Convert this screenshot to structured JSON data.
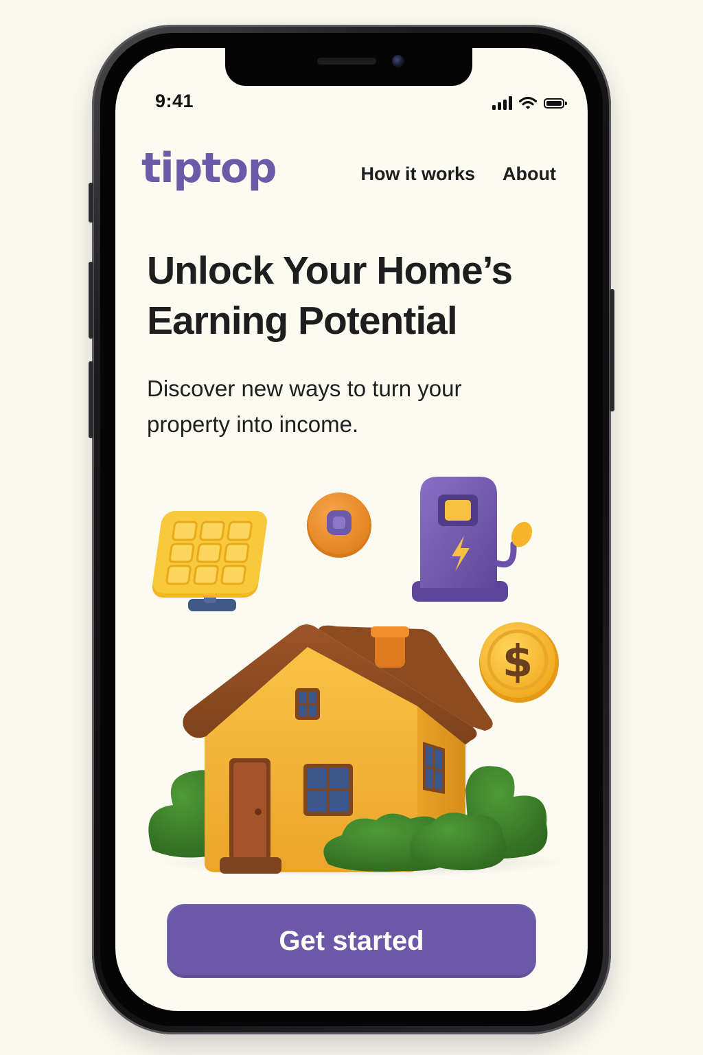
{
  "status_bar": {
    "time": "9:41",
    "signal_icon": "cellular-signal-icon",
    "wifi_icon": "wifi-icon",
    "battery_icon": "battery-icon"
  },
  "header": {
    "logo": "tiptop",
    "nav": [
      {
        "label": "How it works"
      },
      {
        "label": "About"
      }
    ]
  },
  "hero": {
    "title": "Unlock Your Home’s Earning Potential",
    "subtitle": "Discover new ways to turn your property into income."
  },
  "illustration": {
    "items": [
      "solar-panel-icon",
      "smart-sensor-icon",
      "ev-charger-icon",
      "dollar-coin-icon",
      "house-icon",
      "bushes"
    ],
    "coin_symbol": "$"
  },
  "cta": {
    "label": "Get started"
  },
  "colors": {
    "brand": "#6b58a7",
    "background": "#fcfbf2",
    "text": "#1e1e1e",
    "house_wall": "#f5b335",
    "roof": "#8b4a22",
    "foliage": "#3f7d2c"
  }
}
